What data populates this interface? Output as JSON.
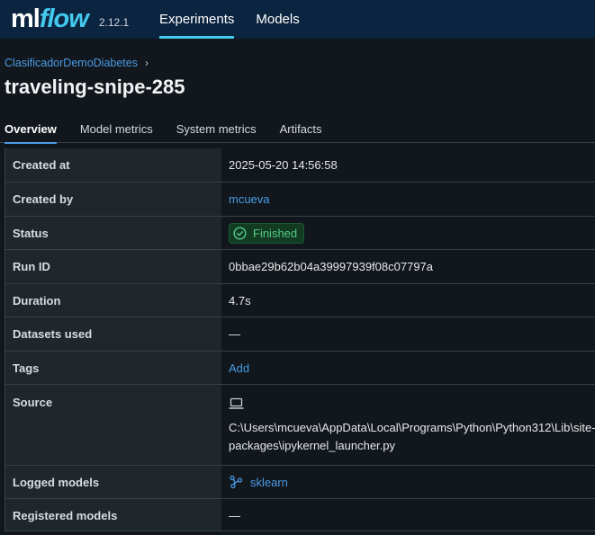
{
  "app": {
    "logo_ml": "ml",
    "logo_flow": "flow",
    "version": "2.12.1",
    "nav": [
      {
        "label": "Experiments",
        "active": true
      },
      {
        "label": "Models",
        "active": false
      }
    ]
  },
  "breadcrumb": {
    "experiment": "ClasificadorDemoDiabetes",
    "separator": "›"
  },
  "run": {
    "title": "traveling-snipe-285"
  },
  "tabs": [
    {
      "label": "Overview",
      "active": true
    },
    {
      "label": "Model metrics",
      "active": false
    },
    {
      "label": "System metrics",
      "active": false
    },
    {
      "label": "Artifacts",
      "active": false
    }
  ],
  "details": {
    "created_at": {
      "label": "Created at",
      "value": "2025-05-20 14:56:58"
    },
    "created_by": {
      "label": "Created by",
      "value": "mcueva"
    },
    "status": {
      "label": "Status",
      "value": "Finished"
    },
    "run_id": {
      "label": "Run ID",
      "value": "0bbae29b62b04a39997939f08c07797a"
    },
    "duration": {
      "label": "Duration",
      "value": "4.7s"
    },
    "datasets": {
      "label": "Datasets used",
      "value": "—"
    },
    "tags": {
      "label": "Tags",
      "value": "Add"
    },
    "source": {
      "label": "Source",
      "icon": "laptop-icon",
      "line1": "C:\\Users\\mcueva\\AppData\\Local\\Programs\\Python\\Python312\\Lib\\site-",
      "line2": "packages\\ipykernel_launcher.py"
    },
    "logged_models": {
      "label": "Logged models",
      "value": "sklearn",
      "icon": "model-icon"
    },
    "registered_models": {
      "label": "Registered models",
      "value": "—"
    }
  },
  "colors": {
    "topbar": "#0b2440",
    "accent": "#43c9ed",
    "link": "#4a9ae5",
    "status_green": "#54c984",
    "background": "#11171c"
  }
}
